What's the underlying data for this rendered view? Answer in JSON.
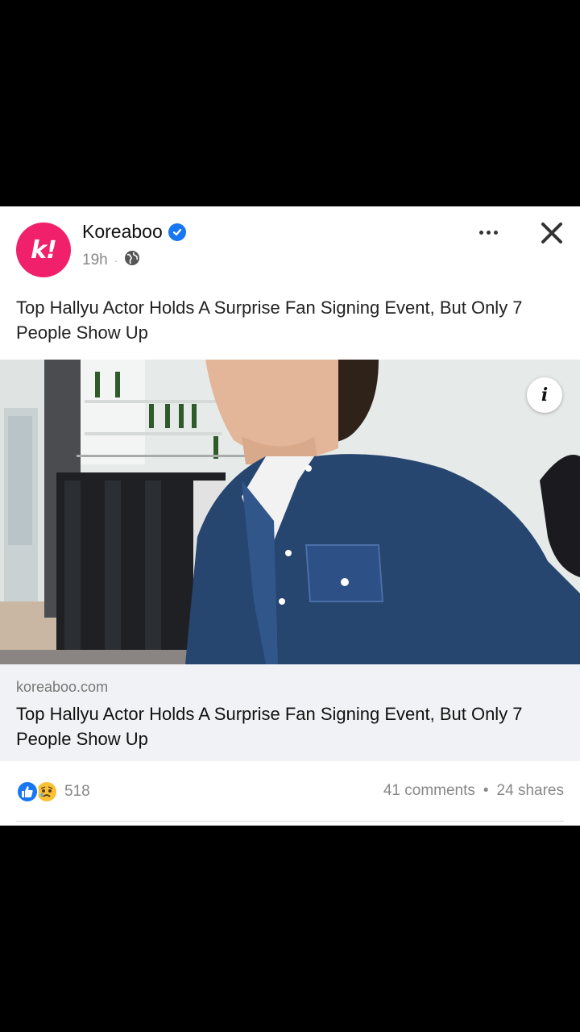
{
  "post": {
    "author": "Koreaboo",
    "avatar_mark": "k!",
    "time": "19h",
    "caption": "Top Hallyu Actor Holds A Surprise Fan Signing Event, But Only 7 People Show Up",
    "link": {
      "domain": "koreaboo.com",
      "title": "Top Hallyu Actor Holds A Surprise Fan Signing Event, But Only 7 People Show Up"
    },
    "stats": {
      "reaction_count": "518",
      "comments": "41 comments",
      "shares": "24 shares",
      "separator": "•"
    },
    "info_label": "i"
  },
  "colors": {
    "brand": "#f0206a",
    "verified": "#1877f2",
    "like": "#1877f2",
    "sad": "#f7c133",
    "link_bg": "#f1f2f5"
  },
  "icons": [
    "verified-badge-icon",
    "globe-icon",
    "more-options-icon",
    "close-icon",
    "info-icon",
    "like-reaction-icon",
    "sad-reaction-icon"
  ]
}
